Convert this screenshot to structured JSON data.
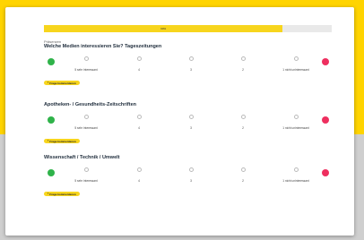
{
  "progress": {
    "label": "60%",
    "percent": 83
  },
  "questions": [
    {
      "pretext": "Präsenzen",
      "title": "Welche Medien interessieren Sie? Tageszeitungen",
      "columns": [
        "5 sehr interessant",
        "4",
        "3",
        "2",
        "1 nicht uninteressant"
      ],
      "comment_label": "Frage kommentieren"
    },
    {
      "pretext": "",
      "title": "Apotheken- / Gesundheits-Zeitschriften",
      "columns": [
        "5 sehr interessant",
        "4",
        "3",
        "2",
        "1 nicht uninteressant"
      ],
      "comment_label": "Frage kommentieren"
    },
    {
      "pretext": "",
      "title": "Wissenschaft / Technik / Umwelt",
      "columns": [
        "5 sehr interessant",
        "4",
        "3",
        "2",
        "1 nicht uninteressant"
      ],
      "comment_label": "Frage kommentieren"
    }
  ],
  "colors": {
    "accent": "#f7d51d",
    "positive": "#2fb34a",
    "negative": "#ee2f5f"
  },
  "icons": {
    "comment": "comment-icon"
  }
}
